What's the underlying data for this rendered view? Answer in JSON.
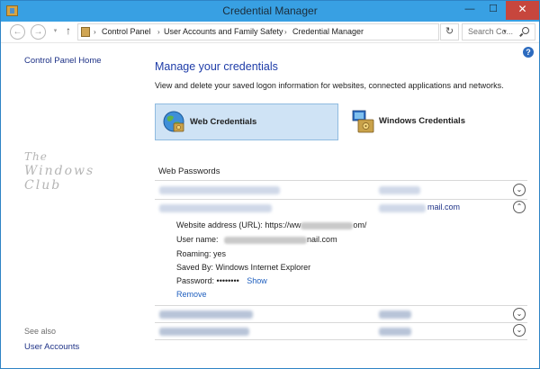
{
  "window": {
    "title": "Credential Manager",
    "minimize_label": "—",
    "maximize_label": "☐",
    "close_label": "✕"
  },
  "address": {
    "back_glyph": "←",
    "forward_glyph": "→",
    "recent_glyph": "▾",
    "up_glyph": "↑",
    "crumbs": [
      "Control Panel",
      "User Accounts and Family Safety",
      "Credential Manager"
    ],
    "separator": "›",
    "dropdown_glyph": "▾",
    "refresh_glyph": "↻",
    "search_placeholder": "Search Co..."
  },
  "sidebar": {
    "home_link": "Control Panel Home",
    "see_also": "See also",
    "user_accounts_link": "User Accounts"
  },
  "watermark": {
    "line1": "The",
    "line2": "Windows Club"
  },
  "help_glyph": "?",
  "main": {
    "heading": "Manage your credentials",
    "subtitle": "View and delete your saved logon information for websites, connected applications and networks.",
    "tabs": {
      "web": "Web Credentials",
      "windows": "Windows Credentials"
    },
    "section_title": "Web Passwords",
    "expanded_user_suffix": "mail.com",
    "details": {
      "address_label": "Website address (URL):",
      "address_prefix": "https://ww",
      "address_suffix": "om/",
      "user_label": "User name:",
      "user_suffix": "nail.com",
      "roaming_label": "Roaming:",
      "roaming_value": "yes",
      "saved_by_label": "Saved By:",
      "saved_by_value": "Windows Internet Explorer",
      "password_label": "Password:",
      "password_value": "••••••••",
      "show_link": "Show",
      "remove_link": "Remove"
    },
    "chevron_down": "⌄",
    "chevron_up": "⌃"
  },
  "colors": {
    "titlebar": "#38a0e3",
    "close_button": "#c7463d",
    "heading": "#1e3ca8",
    "link": "#1f5fbf",
    "selected_tab": "#cfe3f5"
  }
}
